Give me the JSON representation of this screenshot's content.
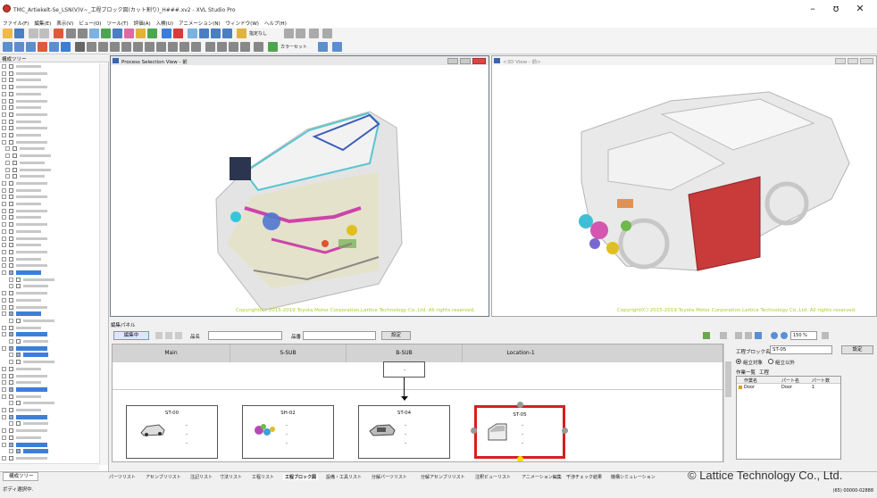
{
  "app": {
    "title": "TMC_Artiekelt-Se_LSN(V)V~_工程ブロック図(カット割り)_H###.xv2 - XVL Studio Pro"
  },
  "window_controls": {
    "minimize": "–",
    "maximize": "ʊ",
    "close": "✕"
  },
  "menu": [
    "ファイル(F)",
    "編集(E)",
    "表示(V)",
    "ビュー(O)",
    "ツール(T)",
    "評価(A)",
    "入検(U)",
    "アニメーション(N)",
    "ウィンドウ(W)",
    "ヘルプ(H)"
  ],
  "toolbar": {
    "dropdown1": "指定なし",
    "dropdown2": "カラーセット"
  },
  "tree": {
    "title": "構成ツリー"
  },
  "views": {
    "process": {
      "title": "Process Selection View - 前"
    },
    "view3d": {
      "title": "<3D View - 前>"
    },
    "copyright": "Copyright(C) 2015-2019 Toyota Motor Corporation,Lattice Technology Co.,Ltd. All rights reserved."
  },
  "edit_panel": {
    "title": "編集パネル",
    "edit_button": "編集中",
    "name_label": "品名",
    "part_no_label": "品番",
    "settings_button": "設定"
  },
  "flow": {
    "columns": [
      "Main",
      "S-SUB",
      "B-SUB",
      "Location-1"
    ],
    "top_box_dot": "-",
    "stations": [
      {
        "name": "ST-00",
        "lines": [
          "-",
          "-",
          "-"
        ]
      },
      {
        "name": "SH-02",
        "lines": [
          "-",
          "-",
          "-"
        ]
      },
      {
        "name": "ST-04",
        "lines": [
          "-",
          "-",
          "-"
        ]
      },
      {
        "name": "ST-05",
        "lines": [
          "-",
          "-",
          "-"
        ]
      }
    ]
  },
  "right_panel": {
    "block_name_label": "工程ブロック名",
    "block_name_value": "ST-05",
    "settings_button": "設定",
    "radio1": "組立対象",
    "radio2": "組立以外",
    "list_label": "作業一覧",
    "list_tab": "工程",
    "col_work": "作業名",
    "col_part": "パート名",
    "col_count": "パート数",
    "row": {
      "work": "Door",
      "part": "Door",
      "count": "1"
    }
  },
  "zoom": "150 %",
  "bottom_tabs": [
    "パーツリスト",
    "アセンブリリスト",
    "注記リスト",
    "寸法リスト",
    "工程リスト",
    "工程ブロック図",
    "設備・工具リスト",
    "分解パーツリスト",
    "分解アセンブリリスト",
    "注釈ビューリスト",
    "アニメーション編集",
    "干渉チェック結果",
    "機構シミュレーション"
  ],
  "tree_tab": "構成ツリー",
  "status": {
    "left": "ボディ選択中.",
    "right": "(65) 00000-02888"
  },
  "watermark": "© Lattice Technology Co., Ltd."
}
